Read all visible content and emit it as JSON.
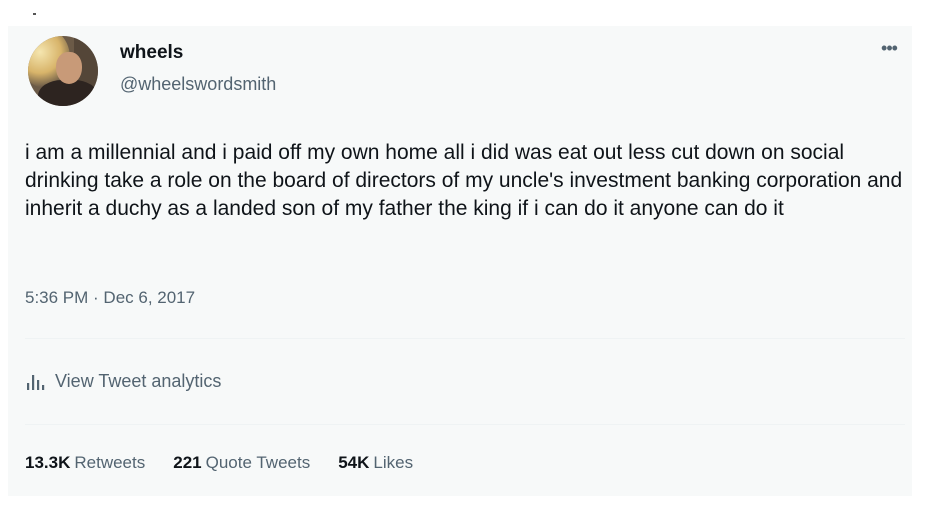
{
  "tweet": {
    "author": {
      "display_name": "wheels",
      "handle": "@wheelswordsmith"
    },
    "menu_icon": "more-horizontal-icon",
    "text": "i am a millennial and i paid off my own home all i did was eat out less cut down on social drinking take a role on the board of directors of my uncle's investment banking corporation and inherit a duchy as a landed son of my father the king if i can do it anyone can do it",
    "timestamp": "5:36 PM · Dec 6, 2017",
    "analytics": {
      "icon": "bar-chart-icon",
      "label": "View Tweet analytics"
    },
    "stats": {
      "retweets": {
        "count": "13.3K",
        "label": "Retweets"
      },
      "quotes": {
        "count": "221",
        "label": "Quote Tweets"
      },
      "likes": {
        "count": "54K",
        "label": "Likes"
      }
    }
  },
  "colors": {
    "card_background": "#f7f9f9",
    "primary_text": "#0f1419",
    "secondary_text": "#536471",
    "divider": "#eff3f4"
  }
}
